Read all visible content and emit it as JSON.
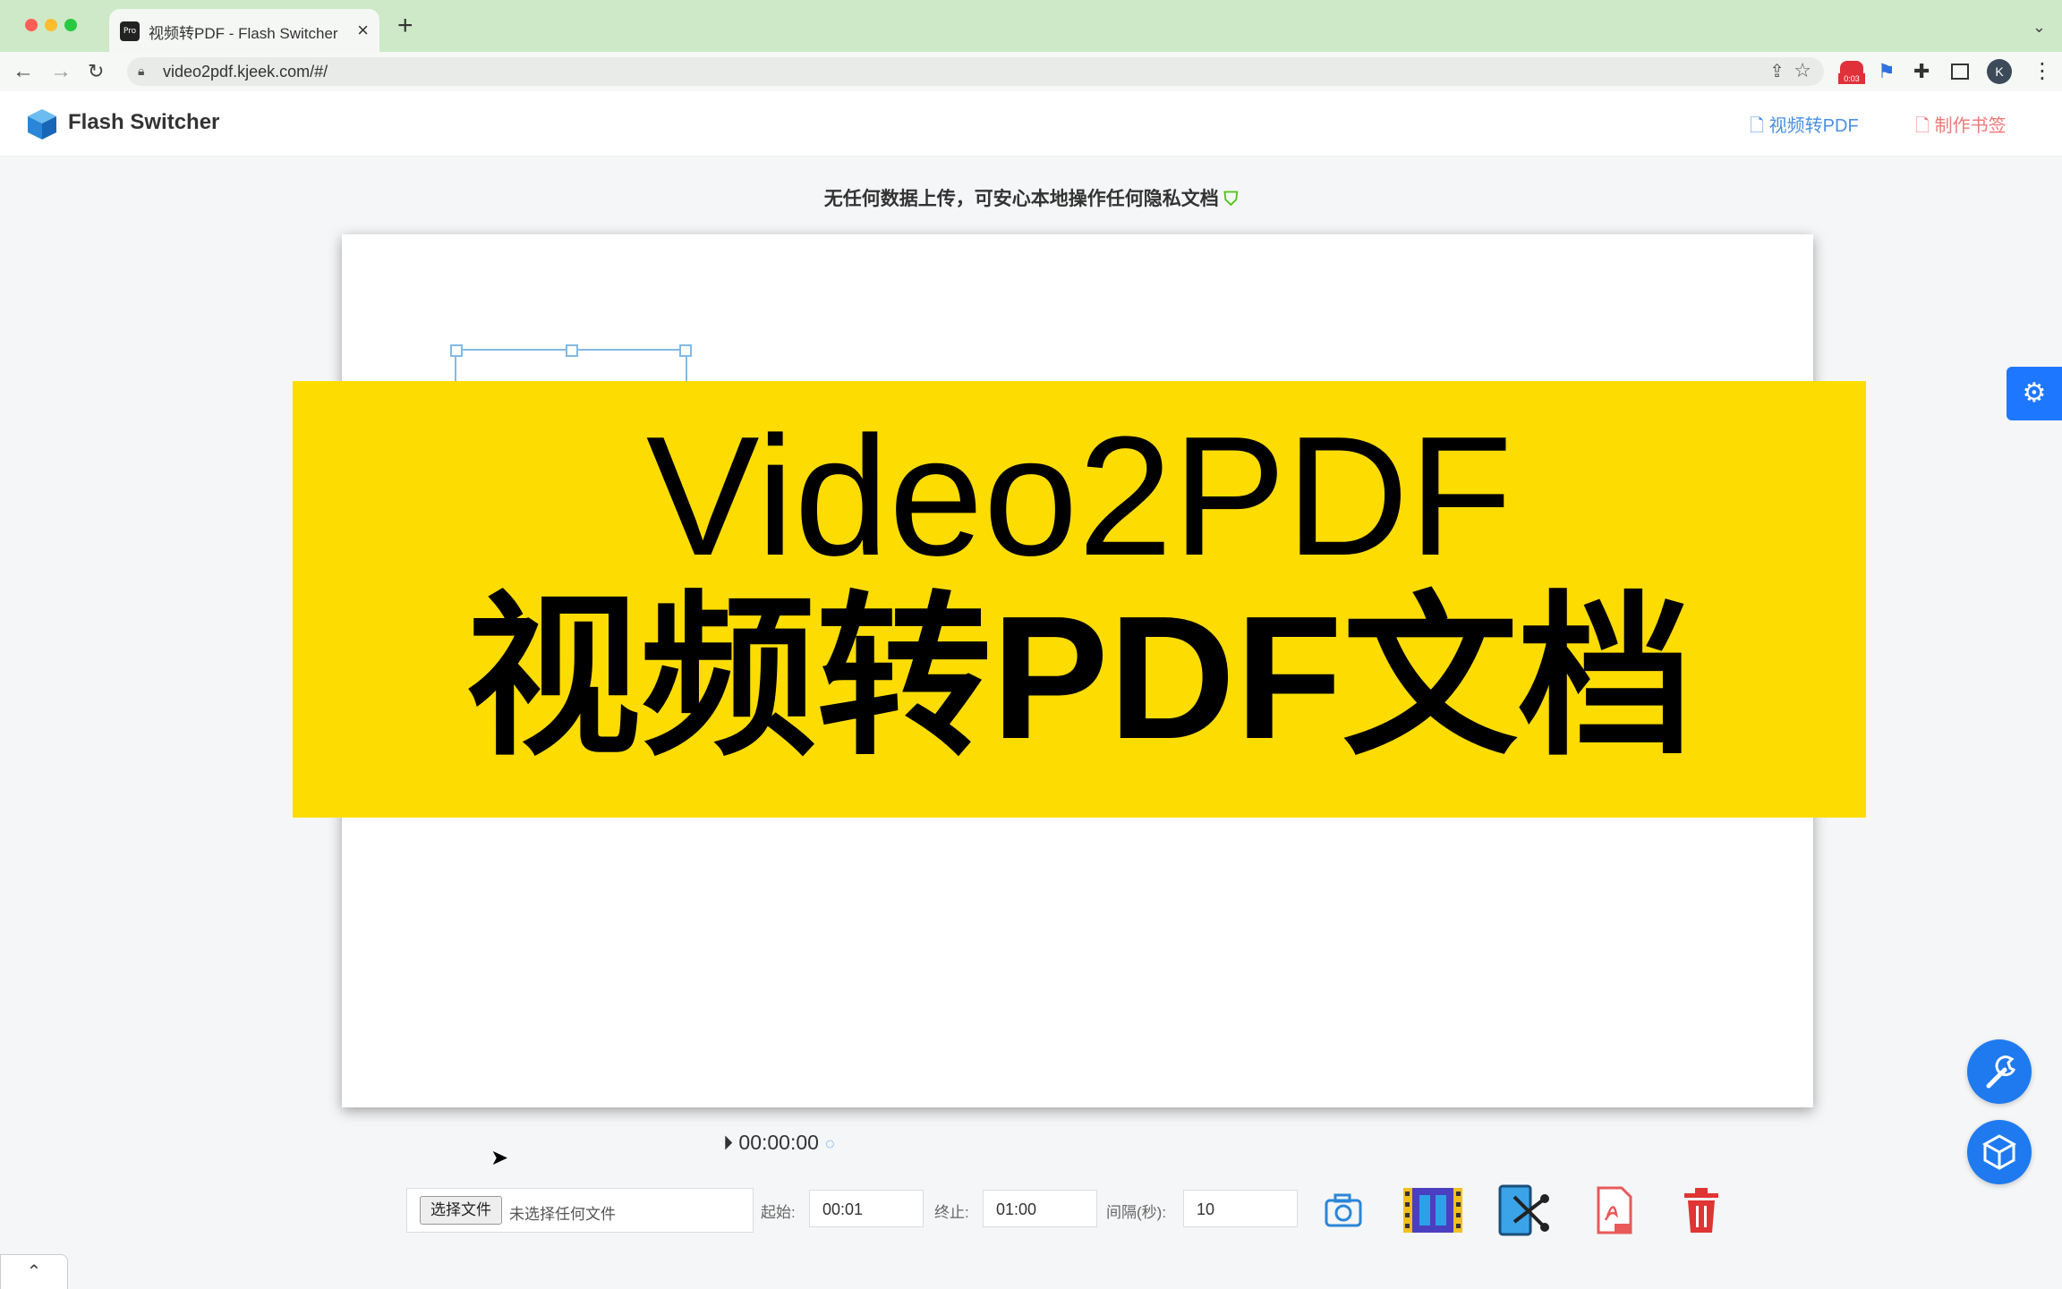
{
  "browser": {
    "tab_title": "视频转PDF - Flash Switcher",
    "tab_favicon": "Pro",
    "url": "video2pdf.kjeek.com/#/",
    "ext_badge": "0:03",
    "profile_initial": "K"
  },
  "header": {
    "logo_text": "Flash Switcher",
    "nav": [
      {
        "label": "视频转PDF",
        "color": "#4a90e2"
      },
      {
        "label": "制作书签",
        "color": "#f07878"
      }
    ]
  },
  "notice": "无任何数据上传，可安心本地操作任何隐私文档",
  "banner": {
    "line1": "Video2PDF",
    "line2": "视频转PDF文档",
    "color": "#fddc01"
  },
  "player": {
    "time": "00:00:00"
  },
  "controls": {
    "choose_file": "选择文件",
    "no_file": "未选择任何文件",
    "start_label": "起始:",
    "start_value": "00:01",
    "end_label": "终止:",
    "end_value": "01:00",
    "interval_label": "间隔(秒):",
    "interval_value": "10"
  },
  "icons": [
    "camera-icon",
    "film-icon",
    "cut-icon",
    "pdf-icon",
    "trash-icon",
    "gear-icon",
    "wrench-icon",
    "cube-icon"
  ]
}
